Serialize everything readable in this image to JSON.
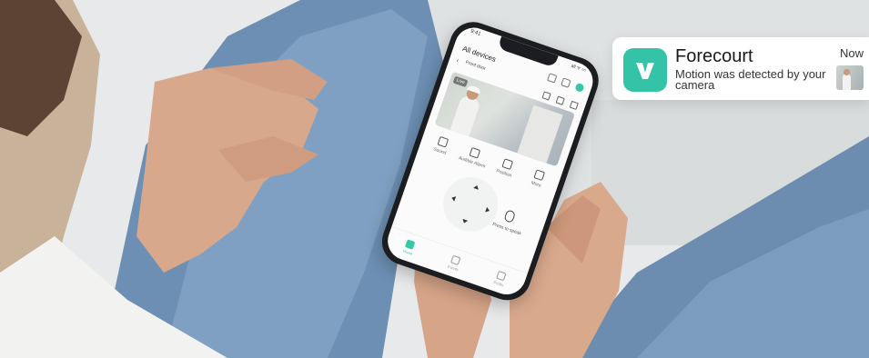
{
  "phone": {
    "status_time": "9:41",
    "status_icons": "all ᯤ ▭",
    "screen_title": "All devices",
    "back_glyph": "‹",
    "camera_name": "Front door",
    "live_badge": "Live",
    "controls": [
      {
        "label": "Sound",
        "icon": "speaker-icon"
      },
      {
        "label": "Audible Alarm",
        "icon": "alarm-icon"
      },
      {
        "label": "Position",
        "icon": "position-icon"
      },
      {
        "label": "More",
        "icon": "more-icon"
      }
    ],
    "press_to_speak": "Press to speak",
    "tabs": [
      {
        "label": "Home",
        "active": true
      },
      {
        "label": "Events",
        "active": false
      },
      {
        "label": "Profile",
        "active": false
      }
    ],
    "accent_color": "#36c6a8"
  },
  "notification": {
    "app_name": "Forecourt",
    "message": "Motion was detected by your camera",
    "time": "Now",
    "app_icon": "v-logo-icon",
    "app_icon_color": "#35c3a7"
  }
}
